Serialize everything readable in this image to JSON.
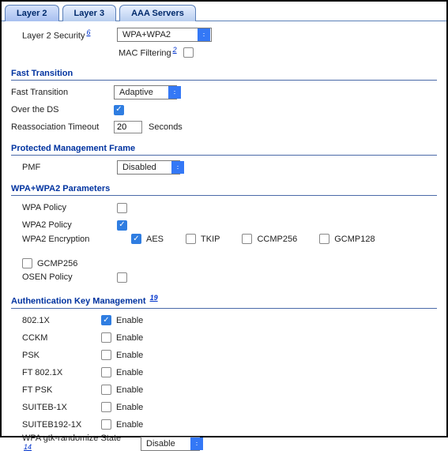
{
  "tabs": {
    "layer2": "Layer 2",
    "layer3": "Layer 3",
    "aaa": "AAA Servers",
    "active": "layer2"
  },
  "l2": {
    "security_label": "Layer 2 Security",
    "security_fn": "6",
    "security_value": "WPA+WPA2",
    "mac_filter_label": "MAC Filtering",
    "mac_filter_fn": "2",
    "mac_filter_checked": false
  },
  "ft": {
    "header": "Fast Transition",
    "ft_label": "Fast Transition",
    "ft_value": "Adaptive",
    "over_ds_label": "Over the DS",
    "over_ds_checked": true,
    "reassoc_label": "Reassociation Timeout",
    "reassoc_value": "20",
    "reassoc_unit": "Seconds"
  },
  "pmf": {
    "header": "Protected Management Frame",
    "pmf_label": "PMF",
    "pmf_value": "Disabled"
  },
  "wpa": {
    "header": "WPA+WPA2 Parameters",
    "wpa_policy_label": "WPA Policy",
    "wpa_policy_checked": false,
    "wpa2_policy_label": "WPA2 Policy",
    "wpa2_policy_checked": true,
    "wpa2_enc_label": "WPA2 Encryption",
    "enc": {
      "aes": {
        "label": "AES",
        "checked": true
      },
      "tkip": {
        "label": "TKIP",
        "checked": false
      },
      "ccmp256": {
        "label": "CCMP256",
        "checked": false
      },
      "gcmp128": {
        "label": "GCMP128",
        "checked": false
      },
      "gcmp256": {
        "label": "GCMP256",
        "checked": false
      }
    },
    "osen_label": "OSEN Policy",
    "osen_checked": false
  },
  "akm": {
    "header": "Authentication Key Management",
    "header_fn": "19",
    "enable_label": "Enable",
    "items": [
      {
        "label": "802.1X",
        "checked": true
      },
      {
        "label": "CCKM",
        "checked": false
      },
      {
        "label": "PSK",
        "checked": false
      },
      {
        "label": "FT 802.1X",
        "checked": false
      },
      {
        "label": "FT PSK",
        "checked": false
      },
      {
        "label": "SUITEB-1X",
        "checked": false
      },
      {
        "label": "SUITEB192-1X",
        "checked": false
      }
    ],
    "gtk_label": "WPA gtk-randomize State",
    "gtk_fn": "14",
    "gtk_value": "Disable"
  }
}
